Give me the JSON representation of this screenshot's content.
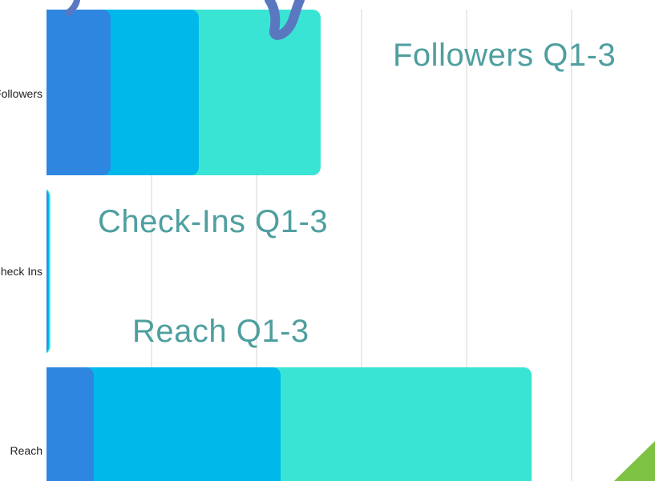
{
  "chart_data": {
    "type": "bar",
    "orientation": "horizontal",
    "stacked": true,
    "categories": [
      "Followers",
      "Check Ins",
      "Reach"
    ],
    "series": [
      {
        "values": [
          610,
          12,
          450
        ],
        "color": "#2e86e0"
      },
      {
        "values": [
          840,
          12,
          1780
        ],
        "color": "#00b8ea"
      },
      {
        "values": [
          1160,
          12,
          2390
        ],
        "color": "#3ae4d4"
      }
    ],
    "xlim": [
      0,
      5500
    ],
    "grid": true
  },
  "labels": {
    "followers": "Followers",
    "checkins": "Check Ins",
    "reach": "Reach"
  },
  "titles": {
    "followers": "Followers Q1-3",
    "checkins": "Check-Ins Q1-3",
    "reach": "Reach Q1-3"
  },
  "decor": {
    "script_color": "#5a78c0",
    "triangle_color": "#7dc242"
  }
}
